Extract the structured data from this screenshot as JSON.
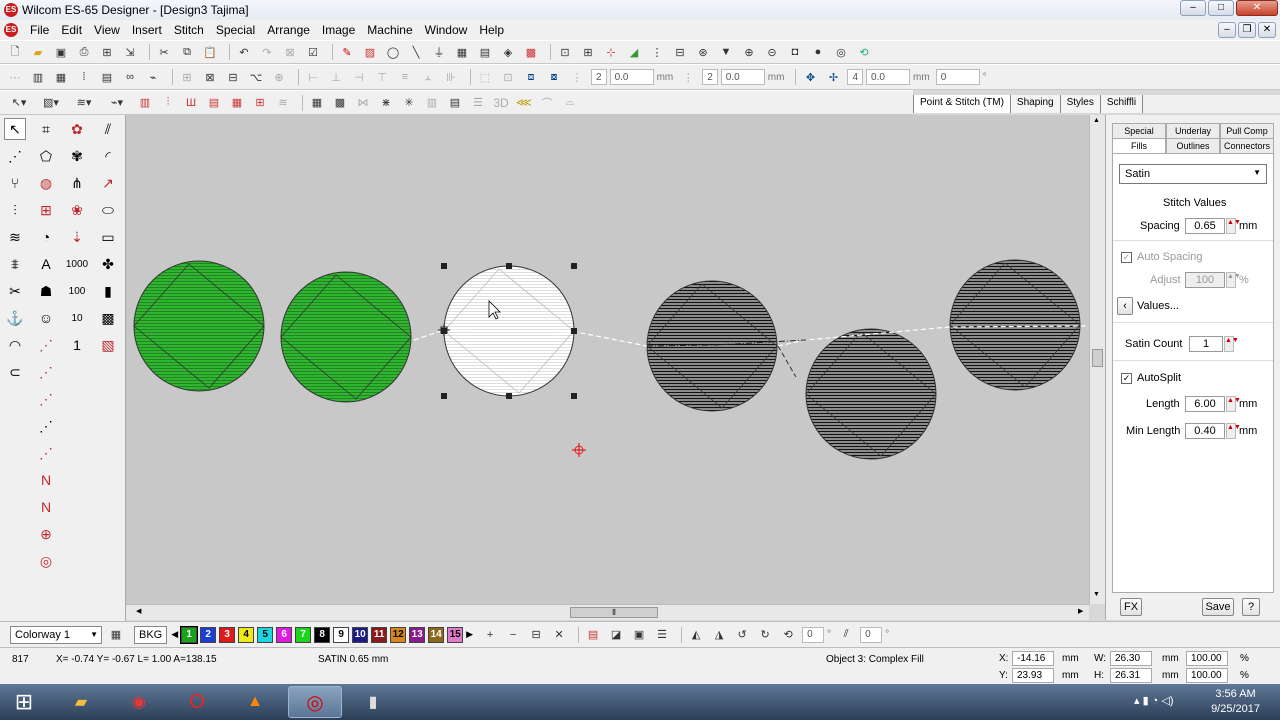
{
  "window": {
    "title": "Wilcom ES-65 Designer - [Design3          Tajima]",
    "app_icon": "ES",
    "minimize": "–",
    "maximize": "□",
    "close": "✕"
  },
  "menu": {
    "logo": "ES",
    "items": [
      "File",
      "Edit",
      "View",
      "Insert",
      "Stitch",
      "Special",
      "Arrange",
      "Image",
      "Machine",
      "Window",
      "Help"
    ],
    "doc_minimize": "–",
    "doc_restore": "❐",
    "doc_close": "✕"
  },
  "toolbar2": {
    "spin1": "2",
    "spin2": "0.0",
    "unit2": "mm",
    "spin3": "2",
    "spin4": "0.0",
    "unit4": "mm",
    "spin5": "4",
    "spin6": "0.0",
    "unit6": "mm",
    "spin7": "0",
    "unit7": "°"
  },
  "toolbar3": {
    "label_3d": "3D"
  },
  "top_tabs": [
    "Point & Stitch (TM)",
    "Shaping",
    "Styles",
    "Schiffli"
  ],
  "panel": {
    "tabs_row1": [
      "Special",
      "Underlay",
      "Pull Comp"
    ],
    "tabs_row2": [
      "Fills",
      "Outlines",
      "Connectors"
    ],
    "fill_type": "Satin",
    "stitch_values_label": "Stitch Values",
    "spacing_label": "Spacing",
    "spacing_value": "0.65",
    "spacing_unit": "mm",
    "auto_spacing_label": "Auto Spacing",
    "adjust_label": "Adjust",
    "adjust_value": "100",
    "adjust_unit": "%",
    "values_button": "Values...",
    "satin_count_label": "Satin Count",
    "satin_count_value": "1",
    "autosplit_label": "AutoSplit",
    "length_label": "Length",
    "length_value": "6.00",
    "length_unit": "mm",
    "min_length_label": "Min Length",
    "min_length_value": "0.40",
    "min_length_unit": "mm",
    "fx_button": "FX",
    "save_button": "Save",
    "help_button": "?"
  },
  "colorbar": {
    "colorway": "Colorway 1",
    "bkg": "BKG",
    "swatches": [
      {
        "n": "1",
        "color": "#1aa31a"
      },
      {
        "n": "2",
        "color": "#1a3fd6"
      },
      {
        "n": "3",
        "color": "#e01a1a"
      },
      {
        "n": "4",
        "color": "#f0e81a"
      },
      {
        "n": "5",
        "color": "#1ad6e0"
      },
      {
        "n": "6",
        "color": "#e01ae0"
      },
      {
        "n": "7",
        "color": "#1ad61a"
      },
      {
        "n": "8",
        "color": "#000000"
      },
      {
        "n": "9",
        "color": "#ffffff"
      },
      {
        "n": "10",
        "color": "#1a1a8a"
      },
      {
        "n": "11",
        "color": "#8a1a1a"
      },
      {
        "n": "12",
        "color": "#d6881a"
      },
      {
        "n": "13",
        "color": "#8a1a8a"
      },
      {
        "n": "14",
        "color": "#8a6a1a"
      },
      {
        "n": "15",
        "color": "#e07acc"
      }
    ],
    "rotate_value": "0",
    "rotate_unit": "°",
    "slant_value": "0",
    "slant_unit": "°"
  },
  "status": {
    "stitch_no": "817",
    "coords": "X= -0.74 Y= -0.67 L=   1.00 A=138.15",
    "stitch_type": "SATIN  0.65 mm",
    "object_info": "Object 3: Complex Fill",
    "x_label": "X:",
    "x_value": "-14.16",
    "x_unit": "mm",
    "y_label": "Y:",
    "y_value": "23.93",
    "y_unit": "mm",
    "w_label": "W:",
    "w_value": "26.30",
    "w_unit": "mm",
    "w_pct": "100.00",
    "w_pct_unit": "%",
    "h_label": "H:",
    "h_value": "26.31",
    "h_unit": "mm",
    "h_pct": "100.00",
    "h_pct_unit": "%"
  },
  "taskbar": {
    "time": "3:56 AM",
    "date": "9/25/2017"
  },
  "design": {
    "colors": {
      "green": "#2fb52f",
      "white": "#ffffff",
      "black": "#1a1a1a"
    }
  }
}
